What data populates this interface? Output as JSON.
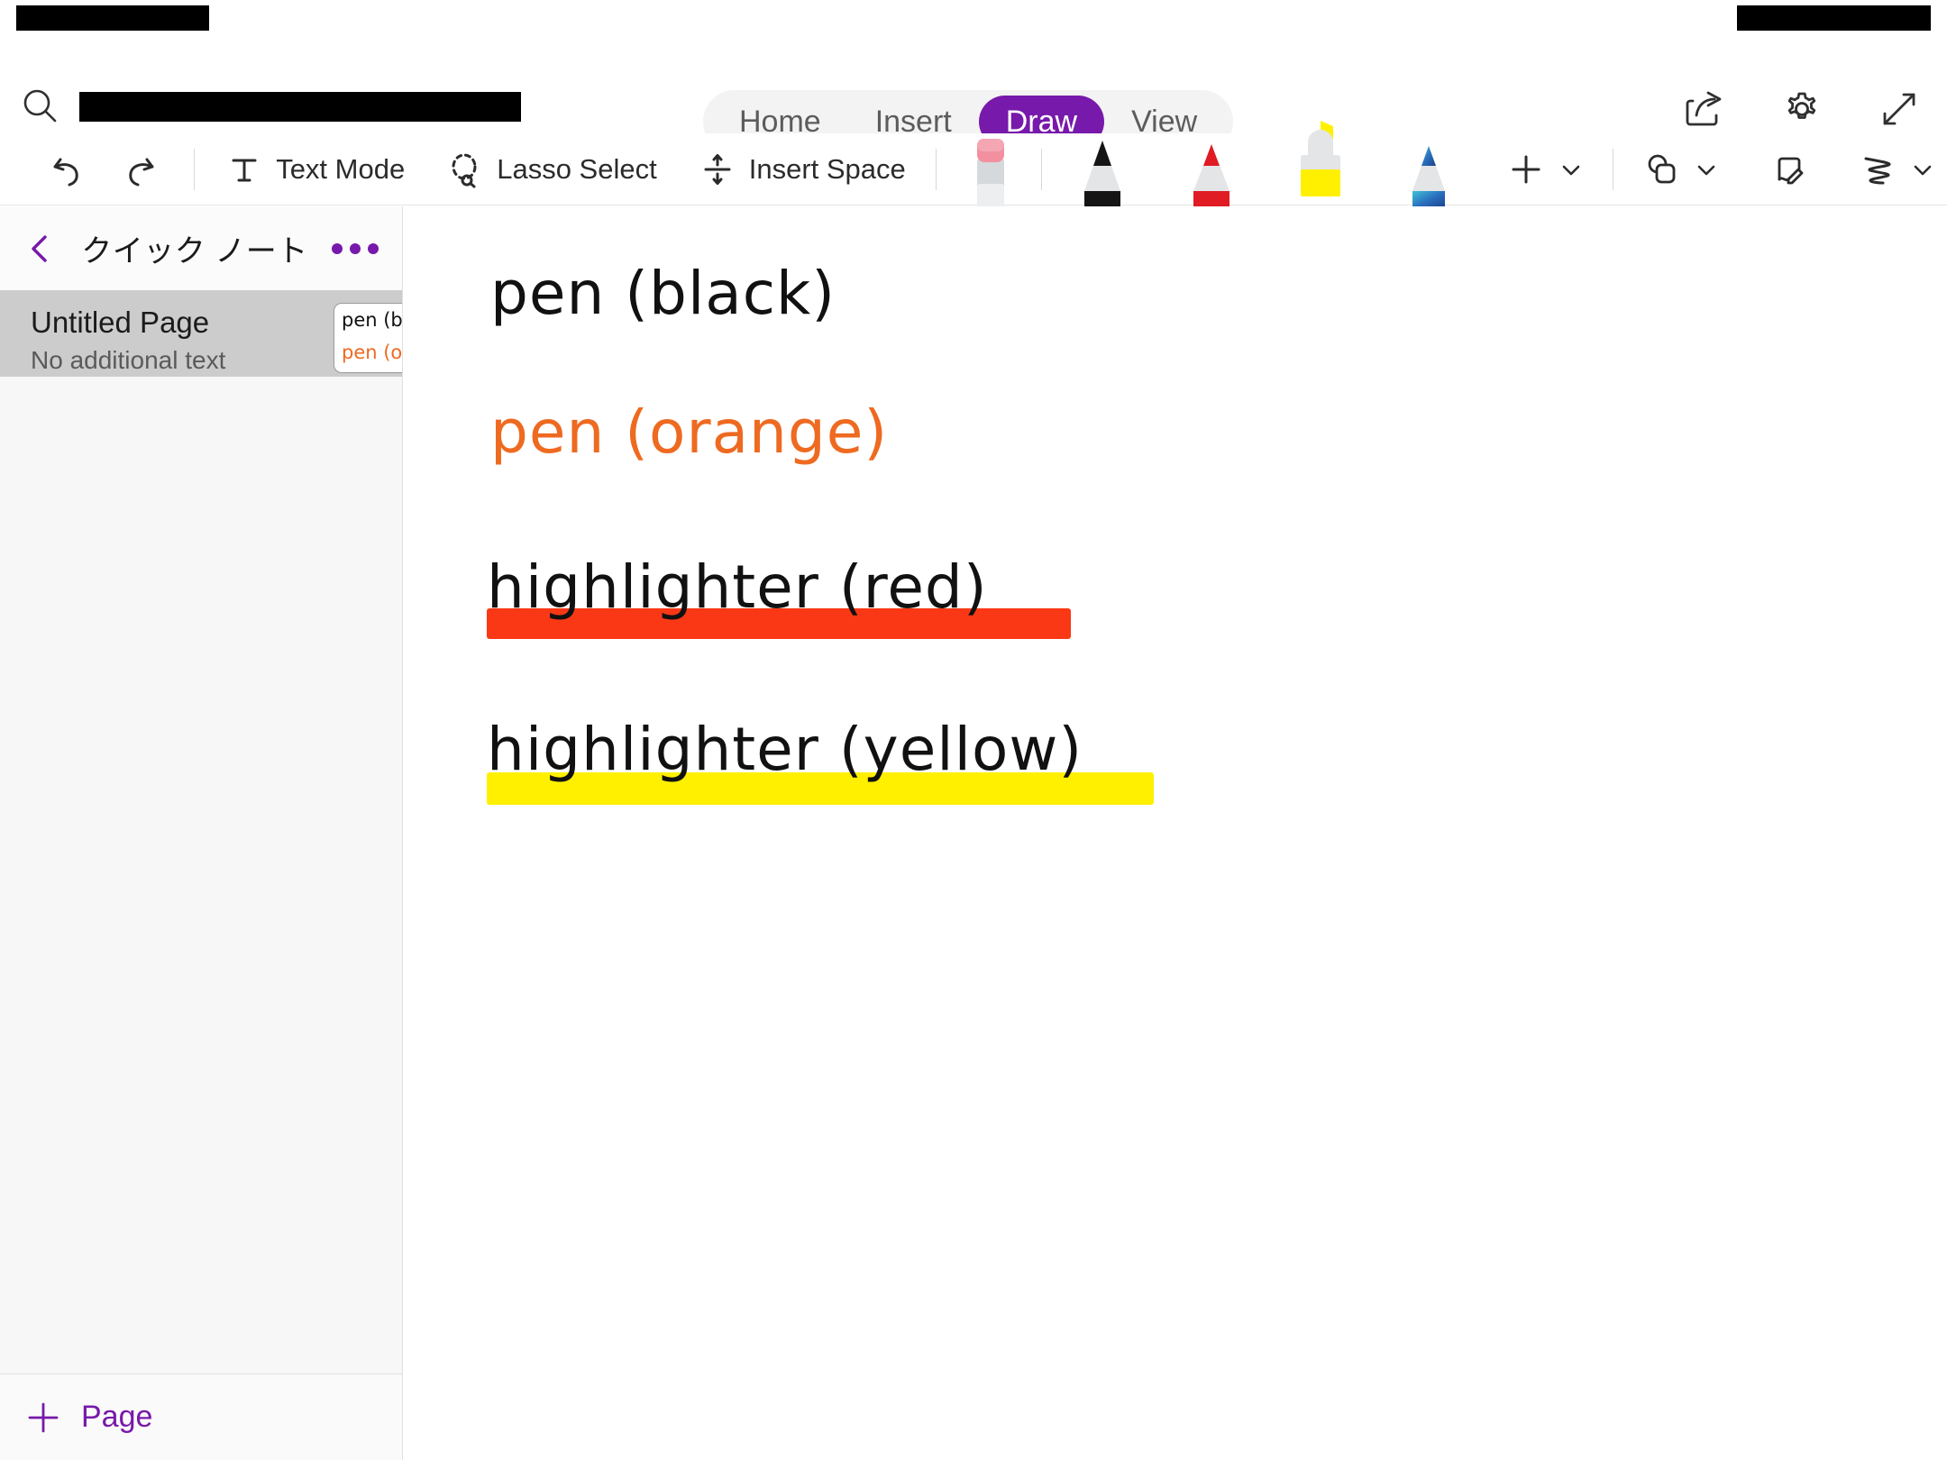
{
  "status_bar": {
    "left_redacted": true,
    "right_redacted": true
  },
  "header": {
    "search": {
      "icon": "search-icon",
      "value_redacted": true,
      "placeholder": ""
    },
    "tabs": [
      {
        "label": "Home",
        "active": false
      },
      {
        "label": "Insert",
        "active": false
      },
      {
        "label": "Draw",
        "active": true
      },
      {
        "label": "View",
        "active": false
      }
    ],
    "actions": [
      {
        "name": "share-icon",
        "label": "Share"
      },
      {
        "name": "gear-icon",
        "label": "Settings"
      },
      {
        "name": "expand-icon",
        "label": "Expand"
      }
    ],
    "accent_color": "#7719aa"
  },
  "toolbar": {
    "undo_label": "Undo",
    "redo_label": "Redo",
    "text_mode_label": "Text Mode",
    "lasso_select_label": "Lasso Select",
    "insert_space_label": "Insert Space",
    "pens": [
      {
        "name": "eraser",
        "label": "Eraser",
        "color": "#f2a0b0",
        "selected": false
      },
      {
        "name": "pen-black",
        "label": "Pen (black)",
        "color": "#111111",
        "selected": false
      },
      {
        "name": "pen-red",
        "label": "Pen (red)",
        "color": "#e01b24",
        "selected": false
      },
      {
        "name": "highlighter-yellow",
        "label": "Highlighter (yellow)",
        "color": "#fff000",
        "selected": true
      },
      {
        "name": "pen-galaxy",
        "label": "Pen (galaxy)",
        "color": "#2aa9c9",
        "selected": false
      }
    ],
    "add_pen_label": "+",
    "shapes_label": "Shapes",
    "ink_to_shape_label": "Ink to Shape",
    "ink_to_text_label": "Ink to Text"
  },
  "sidebar": {
    "back_label": "Back",
    "notebook_title": "クイック ノート",
    "more_label": "More options",
    "pages": [
      {
        "title": "Untitled Page",
        "subtitle": "No additional text",
        "selected": true,
        "thumbnail": {
          "line1": "pen (bl",
          "line2": "pen (ora",
          "line1_color": "#111111",
          "line2_color": "#ee6a21"
        }
      }
    ],
    "add_page_label": "Page"
  },
  "canvas": {
    "ink_lines": [
      {
        "text": "pen (black)",
        "color": "#111111",
        "highlight": null
      },
      {
        "text": "pen (orange)",
        "color": "#ee6a21",
        "highlight": null
      },
      {
        "text": "highlighter (red)",
        "color": "#111111",
        "highlight": "#fa3815"
      },
      {
        "text": "highlighter (yellow)",
        "color": "#111111",
        "highlight": "#fff000"
      }
    ]
  }
}
